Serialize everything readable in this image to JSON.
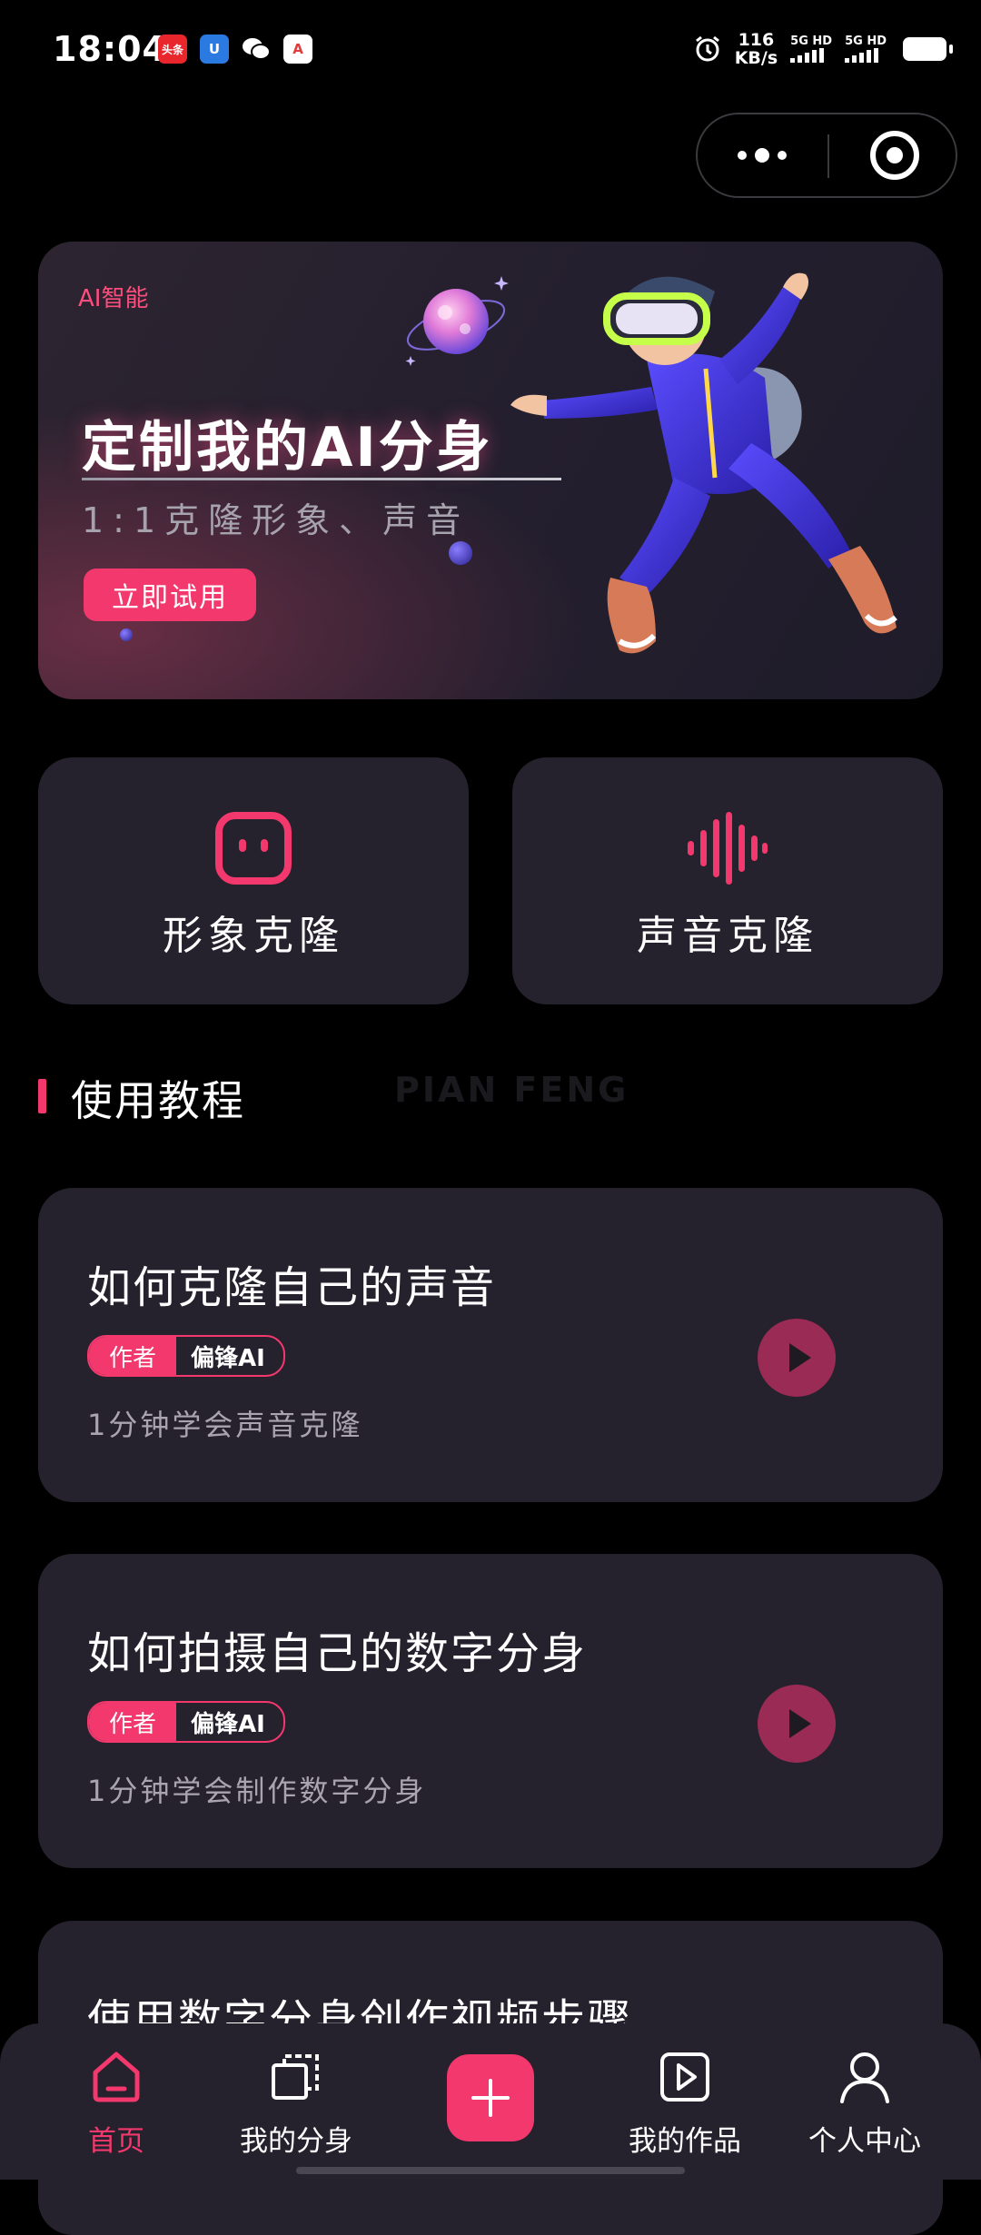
{
  "status_bar": {
    "time": "18:04",
    "notifications": [
      {
        "icon": "toutiao-app-icon",
        "text": "头条",
        "color": "#e8262c"
      },
      {
        "icon": "u-app-icon",
        "text": "U",
        "color": "#2a7ae2"
      },
      {
        "icon": "wechat-icon",
        "text": "",
        "color": "#000000"
      },
      {
        "icon": "a-app-icon",
        "text": "A",
        "color": "#e23b3b"
      }
    ],
    "net_speed_value": "116",
    "net_speed_unit": "KB/s",
    "sim1_label": "5G HD",
    "sim2_label": "5G HD"
  },
  "banner": {
    "tag": "AI智能",
    "title": "定制我的AI分身",
    "subtitle": "1:1克隆形象、声音",
    "button": "立即试用"
  },
  "features": [
    {
      "label": "形象克隆",
      "icon": "robot-face-icon"
    },
    {
      "label": "声音克隆",
      "icon": "sound-wave-icon"
    }
  ],
  "section": {
    "title": "使用教程",
    "watermark": "PIAN FENG"
  },
  "tutorials": [
    {
      "title": "如何克隆自己的声音",
      "role": "作者",
      "author": "偏锋AI",
      "desc": "1分钟学会声音克隆"
    },
    {
      "title": "如何拍摄自己的数字分身",
      "role": "作者",
      "author": "偏锋AI",
      "desc": "1分钟学会制作数字分身"
    },
    {
      "title": "使用数字分身创作视频步骤"
    }
  ],
  "bottom_nav": {
    "items": [
      {
        "label": "首页",
        "icon": "home-icon",
        "active": true
      },
      {
        "label": "我的分身",
        "icon": "layers-icon",
        "active": false
      },
      {
        "label": "",
        "icon": "plus-icon",
        "active": false
      },
      {
        "label": "我的作品",
        "icon": "play-square-icon",
        "active": false
      },
      {
        "label": "个人中心",
        "icon": "user-icon",
        "active": false
      }
    ]
  },
  "colors": {
    "accent": "#f2386d",
    "card": "#25212d",
    "background": "#000000"
  }
}
